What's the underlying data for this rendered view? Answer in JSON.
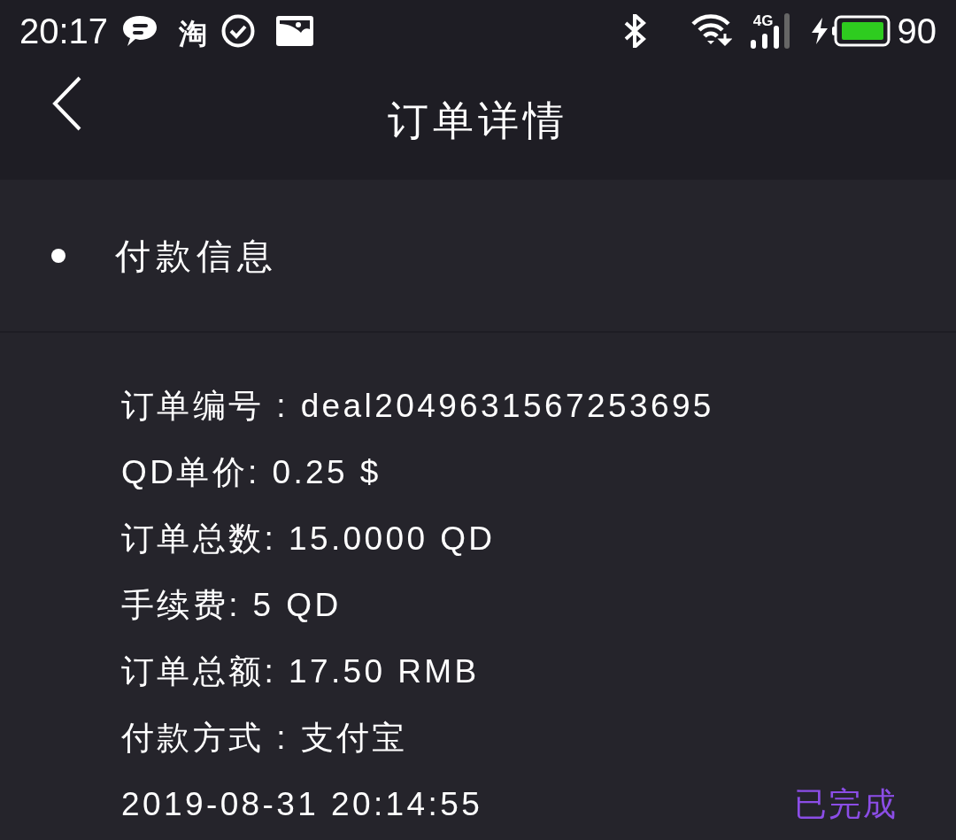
{
  "status_bar": {
    "time": "20:17",
    "app_icons": [
      "淘"
    ],
    "network": "4G",
    "battery": "90"
  },
  "header": {
    "title": "订单详情"
  },
  "section": {
    "title": "付款信息"
  },
  "details": [
    "订单编号 : deal2049631567253695",
    "QD单价: 0.25 $",
    "订单总数: 15.0000 QD",
    "手续费: 5 QD",
    "订单总额: 17.50 RMB",
    "付款方式 : 支付宝"
  ],
  "footer": {
    "datetime": "2019-08-31 20:14:55",
    "status": "已完成"
  }
}
